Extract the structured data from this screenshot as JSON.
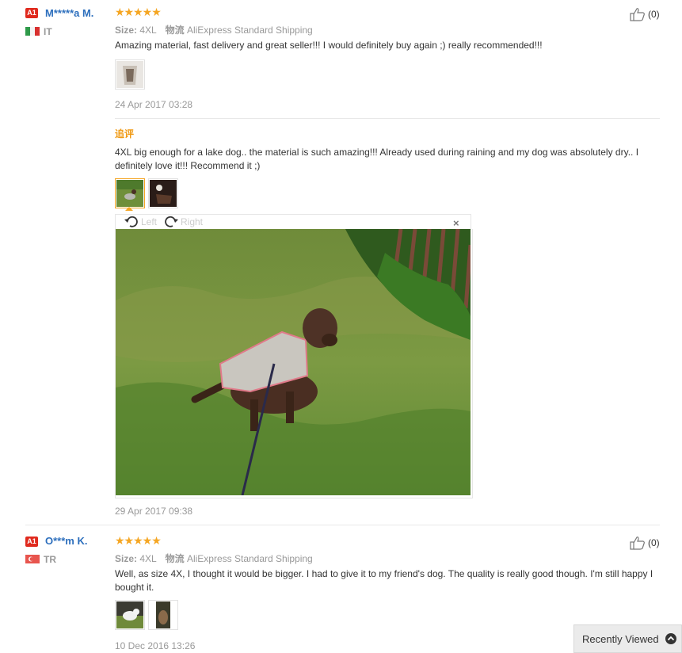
{
  "reviews": [
    {
      "user": "M*****a M.",
      "badge": "A1",
      "country": "IT",
      "likes": "(0)",
      "rating": 5,
      "stars": "★★★★★",
      "size_label": "Size:",
      "size_value": "4XL",
      "logistics_label": "物流",
      "logistics_value": "AliExpress Standard Shipping",
      "text": "Amazing material, fast delivery and great seller!!! I would definitely buy again ;) really recommended!!!",
      "date": "24 Apr 2017 03:28",
      "additional": {
        "label": "追评",
        "text": "4XL big enough for a lake dog.. the material is such amazing!!! Already used during raining and my dog was absolutely dry.. I definitely love it!!! Recommend it ;)",
        "date": "29 Apr 2017 09:38",
        "viewer": {
          "left": "Left",
          "right": "Right",
          "close": "×"
        }
      }
    },
    {
      "user": "O***m K.",
      "badge": "A1",
      "country": "TR",
      "likes": "(0)",
      "rating": 5,
      "stars": "★★★★★",
      "size_label": "Size:",
      "size_value": "4XL",
      "logistics_label": "物流",
      "logistics_value": "AliExpress Standard Shipping",
      "text": "Well, as size 4X, I thought it would be bigger. I had to give it to my friend's dog. The quality is really good though. I'm still happy I bought it.",
      "date": "10 Dec 2016 13:26"
    }
  ],
  "recently_viewed": "Recently Viewed",
  "colors": {
    "accent_orange": "#f09a14",
    "username_blue": "#2d6fbd",
    "badge_red": "#e02a1e"
  },
  "icons": [
    "thumbs-up-icon",
    "rotate-left-icon",
    "rotate-right-icon",
    "close-icon",
    "chevron-up-icon"
  ]
}
